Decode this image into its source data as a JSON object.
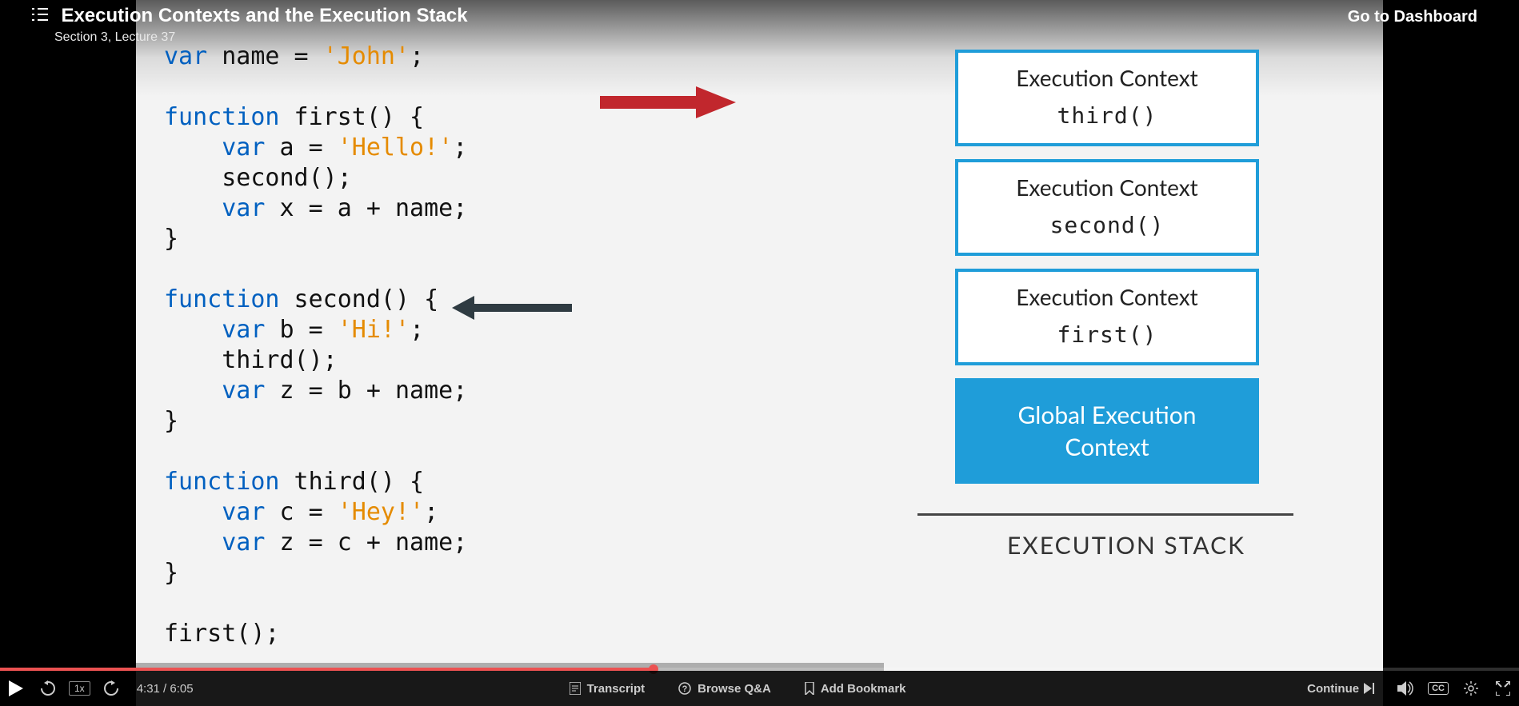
{
  "header": {
    "title": "Execution Contexts and the Execution Stack",
    "subtitle": "Section 3, Lecture 37",
    "dashboard": "Go to Dashboard"
  },
  "code": {
    "l1_kw": "var",
    "l1_rest": " name = ",
    "l1_str": "'John'",
    "l1_end": ";",
    "l2_kw": "function",
    "l2_rest": " first() {",
    "l3_kw": "var",
    "l3_rest": " a = ",
    "l3_str": "'Hello!'",
    "l3_end": ";",
    "l4": "    second();",
    "l5_kw": "var",
    "l5_rest": " x = a + name;",
    "l6": "}",
    "l7_kw": "function",
    "l7_rest": " second() {",
    "l8_kw": "var",
    "l8_rest": " b = ",
    "l8_str": "'Hi!'",
    "l8_end": ";",
    "l9": "    third();",
    "l10_kw": "var",
    "l10_rest": " z = b + name;",
    "l11": "}",
    "l12_kw": "function",
    "l12_rest": " third() {",
    "l13_kw": "var",
    "l13_rest": " c = ",
    "l13_str": "'Hey!'",
    "l13_end": ";",
    "l14_kw": "var",
    "l14_rest": " z = c + name;",
    "l15": "}",
    "l16": "first();"
  },
  "stack": {
    "items": [
      {
        "title": "Execution Context",
        "fn": "third()"
      },
      {
        "title": "Execution Context",
        "fn": "second()"
      },
      {
        "title": "Execution Context",
        "fn": "first()"
      }
    ],
    "global_line1": "Global Execution",
    "global_line2": "Context",
    "label": "EXECUTION STACK"
  },
  "controls": {
    "speed": "1x",
    "time": "4:31 / 6:05",
    "transcript": "Transcript",
    "qa": "Browse Q&A",
    "bookmark": "Add Bookmark",
    "continue": "Continue",
    "cc": "CC"
  },
  "progress": {
    "percent": 43,
    "watched_percent": 60
  }
}
